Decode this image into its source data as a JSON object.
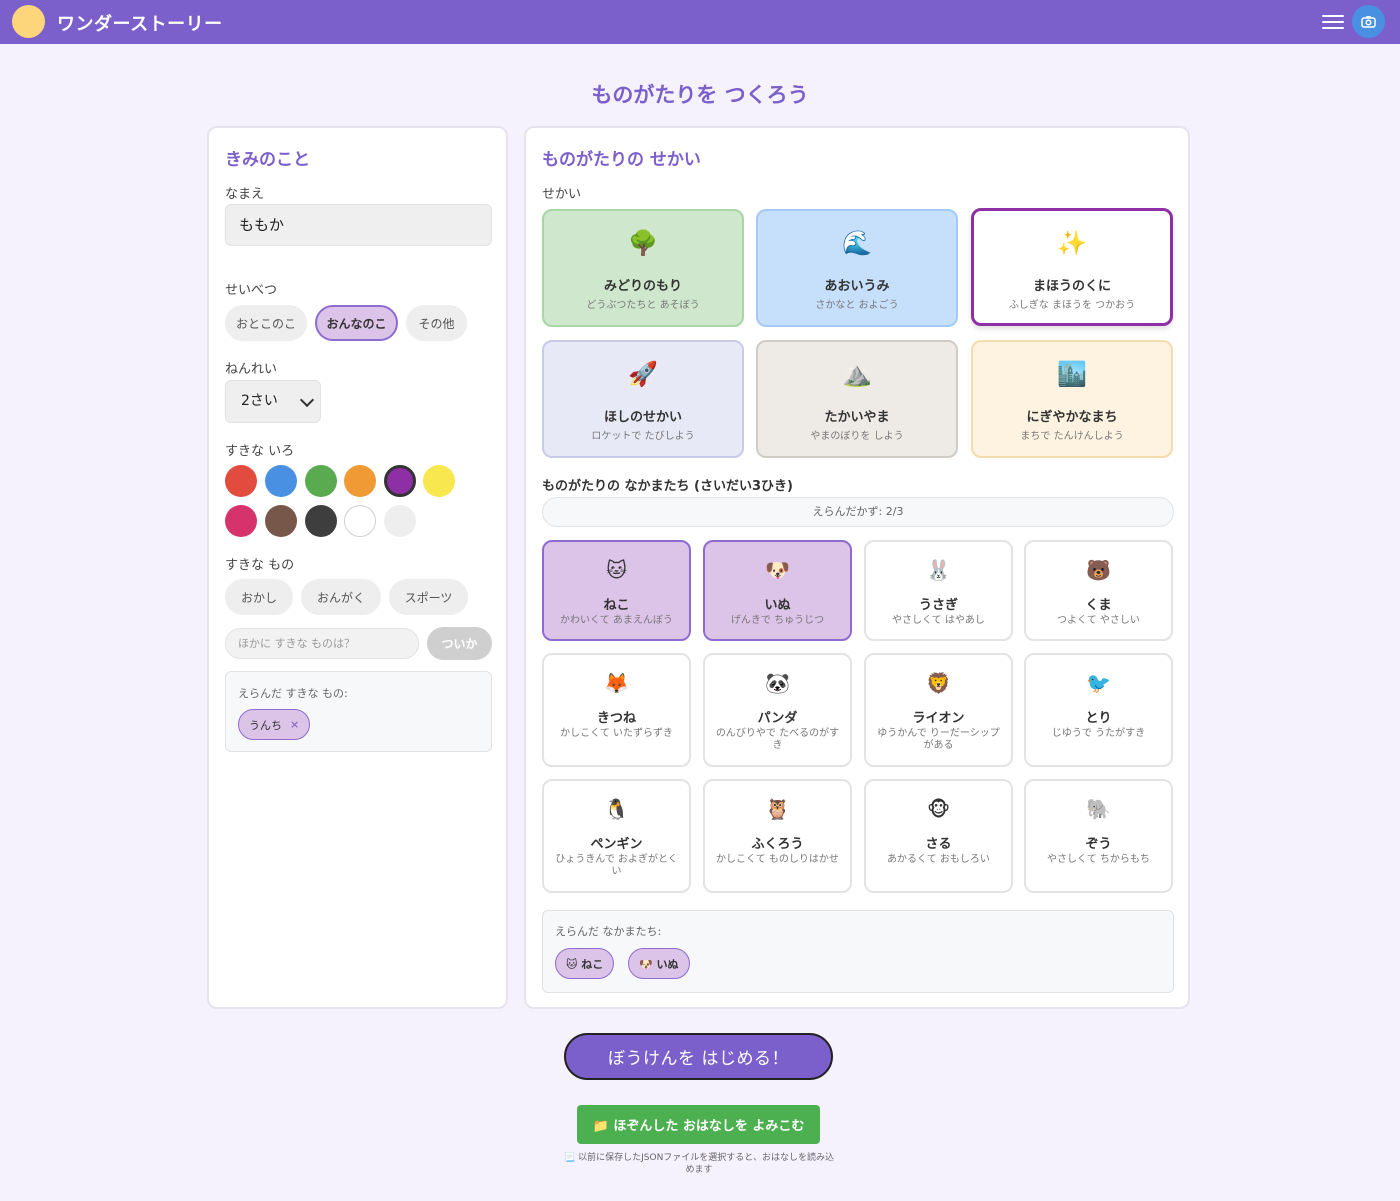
{
  "header": {
    "app_title": "ワンダーストーリー",
    "menu_icon": "hamburger-menu-icon",
    "camera_icon": "camera-icon",
    "colors": {
      "bar": "#7b5fcb",
      "logo": "#fdd57a",
      "camera": "#4a90e2"
    }
  },
  "page_title": "ものがたりを つくろう",
  "profile": {
    "title": "きみのこと",
    "name_label": "なまえ",
    "name_value": "ももか",
    "gender_label": "せいべつ",
    "gender_options": [
      "おとこのこ",
      "おんなのこ",
      "その他"
    ],
    "gender_selected": "おんなのこ",
    "age_label": "ねんれい",
    "age_value": "2さい",
    "color_label": "すきな いろ",
    "colors": [
      "#e24c3f",
      "#4a90e2",
      "#5aab4f",
      "#f09a35",
      "#8e2fa5",
      "#f8e74f",
      "#d6336c",
      "#76574a",
      "#3e3e3e",
      "#ffffff",
      "#eeeeee"
    ],
    "color_selected": "#8e2fa5",
    "likes_label": "すきな もの",
    "likes_options": [
      "おかし",
      "おんがく",
      "スポーツ"
    ],
    "other_placeholder": "ほかに すきな ものは？",
    "add_label": "ついか",
    "selected_caption": "えらんだ すきな もの:",
    "selected_likes": [
      "うんち"
    ],
    "remove_symbol": "×"
  },
  "world": {
    "title": "ものがたりの せかい",
    "label": "せかい",
    "selected": "まほうのくに",
    "options": [
      {
        "emoji": "🌳",
        "name": "みどりのもり",
        "desc": "どうぶつたちと あそぼう",
        "bg": "#cfe8cd",
        "border": "#a8d6a4"
      },
      {
        "emoji": "🌊",
        "name": "あおいうみ",
        "desc": "さかなと およごう",
        "bg": "#c6dffa",
        "border": "#a4c9f2"
      },
      {
        "emoji": "✨",
        "name": "まほうのくに",
        "desc": "ふしぎな まほうを つかおう",
        "bg": "#ffffff",
        "border": "#8e2fa5"
      },
      {
        "emoji": "🚀",
        "name": "ほしのせかい",
        "desc": "ロケットで たびしよう",
        "bg": "#e8e9f7",
        "border": "#c8cae8"
      },
      {
        "emoji": "⛰️",
        "name": "たかいやま",
        "desc": "やまのぼりを しよう",
        "bg": "#eeebe7",
        "border": "#cfcbc5"
      },
      {
        "emoji": "🏙️",
        "name": "にぎやかなまち",
        "desc": "まちで たんけんしよう",
        "bg": "#fdf3e0",
        "border": "#f5dcae"
      }
    ]
  },
  "friends": {
    "label": "ものがたりの なかまたち (さいだい3ひき)",
    "count_text": "えらんだかず: 2/3",
    "options": [
      {
        "emoji": "🐱",
        "name": "ねこ",
        "desc": "かわいくて あまえんぼう",
        "selected": true
      },
      {
        "emoji": "🐶",
        "name": "いぬ",
        "desc": "げんきで ちゅうじつ",
        "selected": true
      },
      {
        "emoji": "🐰",
        "name": "うさぎ",
        "desc": "やさしくて はやあし",
        "selected": false
      },
      {
        "emoji": "🐻",
        "name": "くま",
        "desc": "つよくて やさしい",
        "selected": false
      },
      {
        "emoji": "🦊",
        "name": "きつね",
        "desc": "かしこくて いたずらずき",
        "selected": false
      },
      {
        "emoji": "🐼",
        "name": "パンダ",
        "desc": "のんびりやで たべるのがすき",
        "selected": false
      },
      {
        "emoji": "🦁",
        "name": "ライオン",
        "desc": "ゆうかんで りーだーシップがある",
        "selected": false
      },
      {
        "emoji": "🐦",
        "name": "とり",
        "desc": "じゆうで うたがすき",
        "selected": false
      },
      {
        "emoji": "🐧",
        "name": "ペンギン",
        "desc": "ひょうきんで およぎがとくい",
        "selected": false
      },
      {
        "emoji": "🦉",
        "name": "ふくろう",
        "desc": "かしこくて ものしりはかせ",
        "selected": false
      },
      {
        "emoji": "🐵",
        "name": "さる",
        "desc": "あかるくて おもしろい",
        "selected": false
      },
      {
        "emoji": "🐘",
        "name": "ぞう",
        "desc": "やさしくて ちからもち",
        "selected": false
      }
    ],
    "selected_caption": "えらんだ なかまたち:",
    "selected_tags": [
      "🐱 ねこ",
      "🐶 いぬ"
    ]
  },
  "actions": {
    "start_label": "ぼうけんを はじめる！",
    "load_label": "📁 ほぞんした おはなしを よみこむ",
    "load_note": "📃 以前に保存したJSONファイルを選択すると、おはなしを読み込めます",
    "colors": {
      "start": "#7b5fcb",
      "load": "#4caf50"
    }
  }
}
